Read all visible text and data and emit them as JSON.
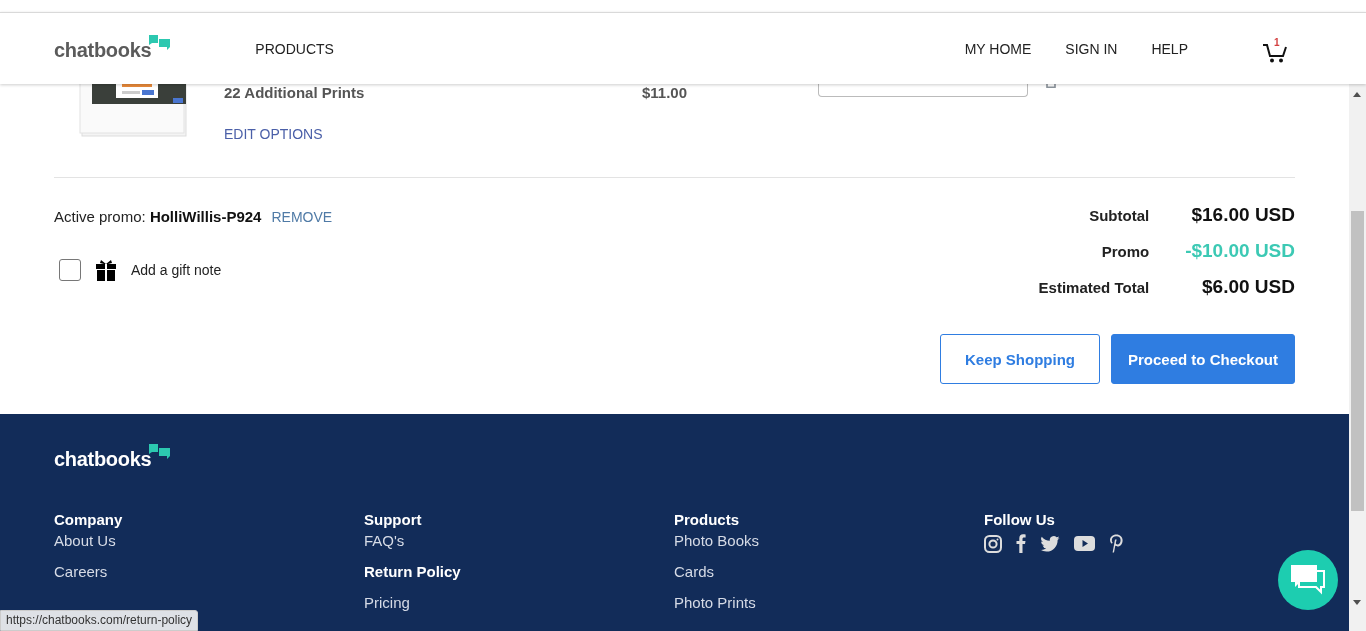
{
  "header": {
    "logo": "chatbooks",
    "nav": [
      "PRODUCTS"
    ],
    "nav_right": [
      "MY HOME",
      "SIGN IN",
      "HELP"
    ],
    "cart_count": "1"
  },
  "cart_item": {
    "title": "22 Additional Prints",
    "price": "$11.00",
    "edit_link": "EDIT OPTIONS"
  },
  "promo": {
    "label": "Active promo:",
    "code": "HolliWillis-P924",
    "remove": "REMOVE"
  },
  "gift_note": {
    "label": "Add a gift note",
    "checked": false
  },
  "summary": [
    {
      "label": "Subtotal",
      "value": "$16.00 USD",
      "kind": "normal"
    },
    {
      "label": "Promo",
      "value": "-$10.00 USD",
      "kind": "discount"
    },
    {
      "label": "Estimated Total",
      "value": "$6.00 USD",
      "kind": "normal"
    }
  ],
  "buttons": [
    {
      "label": "Keep Shopping",
      "kind": "secondary"
    },
    {
      "label": "Proceed to Checkout",
      "kind": "primary"
    }
  ],
  "footer": {
    "logo": "chatbooks",
    "columns": [
      {
        "title": "Company",
        "links": [
          {
            "label": "About Us",
            "hovered": false
          },
          {
            "label": "Careers",
            "hovered": false
          }
        ]
      },
      {
        "title": "Support",
        "links": [
          {
            "label": "FAQ's",
            "hovered": false
          },
          {
            "label": "Return Policy",
            "hovered": true
          },
          {
            "label": "Pricing",
            "hovered": false
          }
        ]
      },
      {
        "title": "Products",
        "links": [
          {
            "label": "Photo Books",
            "hovered": false
          },
          {
            "label": "Cards",
            "hovered": false
          },
          {
            "label": "Photo Prints",
            "hovered": false
          }
        ]
      }
    ],
    "follow_title": "Follow Us"
  },
  "status_bar": "https://chatbooks.com/return-policy"
}
